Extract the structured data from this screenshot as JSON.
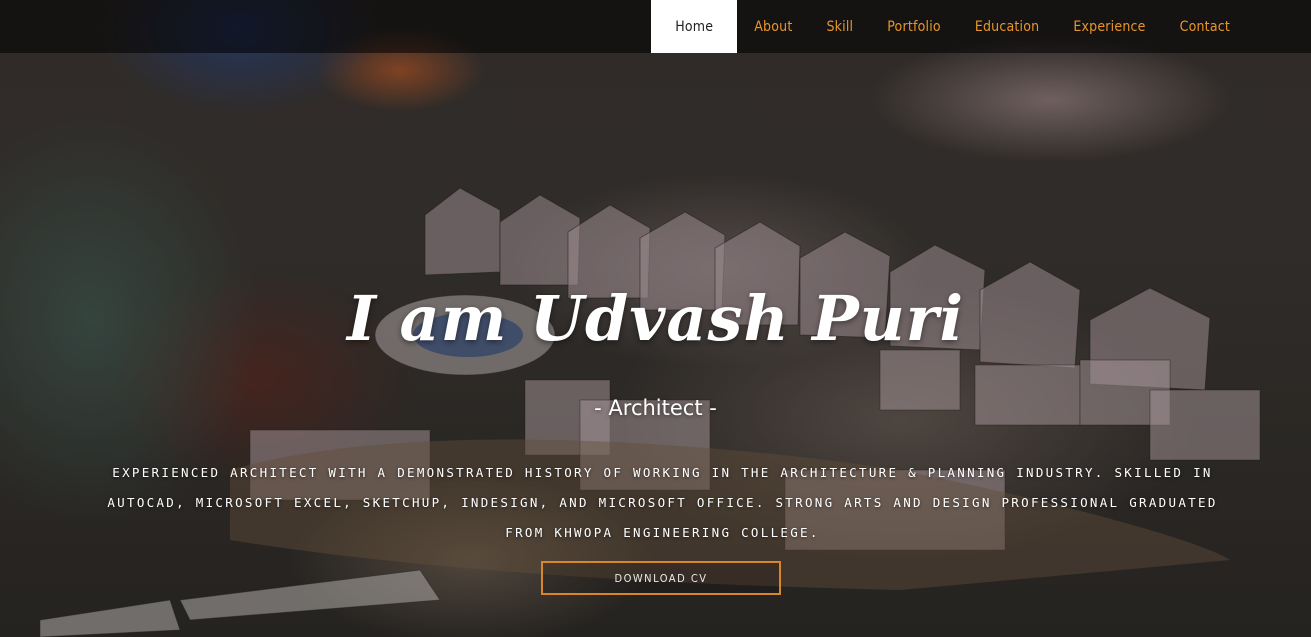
{
  "nav": {
    "items": [
      {
        "label": "Home",
        "active": true
      },
      {
        "label": "About",
        "active": false
      },
      {
        "label": "Skill",
        "active": false
      },
      {
        "label": "Portfolio",
        "active": false
      },
      {
        "label": "Education",
        "active": false
      },
      {
        "label": "Experience",
        "active": false
      },
      {
        "label": "Contact",
        "active": false
      }
    ]
  },
  "hero": {
    "title": "I am Udvash Puri",
    "subtitle": "- Architect -",
    "description": "Experienced Architect with a demonstrated history of working in the architecture & planning industry. Skilled in AutoCAD, Microsoft Excel, SketchUp, InDesign, and Microsoft Office. Strong arts and design professional graduated from Khwopa Engineering College.",
    "cv_button": "DOWNLOAD CV"
  },
  "colors": {
    "accent": "#e8952b",
    "nav_active_bg": "#ffffff",
    "text": "#ffffff"
  }
}
